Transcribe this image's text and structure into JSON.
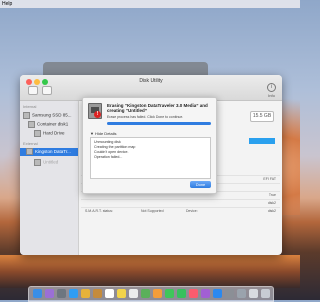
{
  "menubar": {
    "app_menu": "Help",
    "status_right": ""
  },
  "window": {
    "title": "Disk Utility",
    "toolbar_info_label": "Info",
    "toolbar_info_glyph": "i"
  },
  "sidebar": {
    "section_internal": "Internal",
    "section_external": "External",
    "items": [
      {
        "label": "Samsung SSD 85...",
        "selected": false
      },
      {
        "label": "Container disk1",
        "selected": false
      },
      {
        "label": "Hard Drive",
        "selected": false
      },
      {
        "label": "Kingston DataTr...",
        "selected": true
      },
      {
        "label": "Untitled",
        "selected": false
      }
    ]
  },
  "main": {
    "capacity": "15.5 GB",
    "info_rows": [
      [
        "",
        "",
        "",
        "EFI FAT"
      ],
      [
        "",
        "",
        "",
        ""
      ],
      [
        "",
        "",
        "",
        "True"
      ],
      [
        "",
        "",
        "",
        "disk2"
      ],
      [
        "S.M.A.R.T. status:",
        "Not Supported",
        "Device:",
        "disk2"
      ]
    ]
  },
  "sheet": {
    "title": "Erasing “Kingston DataTraveler 3.0 Media” and creating “Untitled”",
    "subtitle": "Erase process has failed. Click Done to continue.",
    "progress": 1.0,
    "details_label": "Hide Details",
    "log": [
      "Unmounting disk",
      "Creating the partition map",
      "Couldn't open device.",
      "Operation failed..."
    ],
    "done_label": "Done"
  },
  "colors": {
    "accent": "#2f7ce0",
    "error": "#dd2222"
  }
}
